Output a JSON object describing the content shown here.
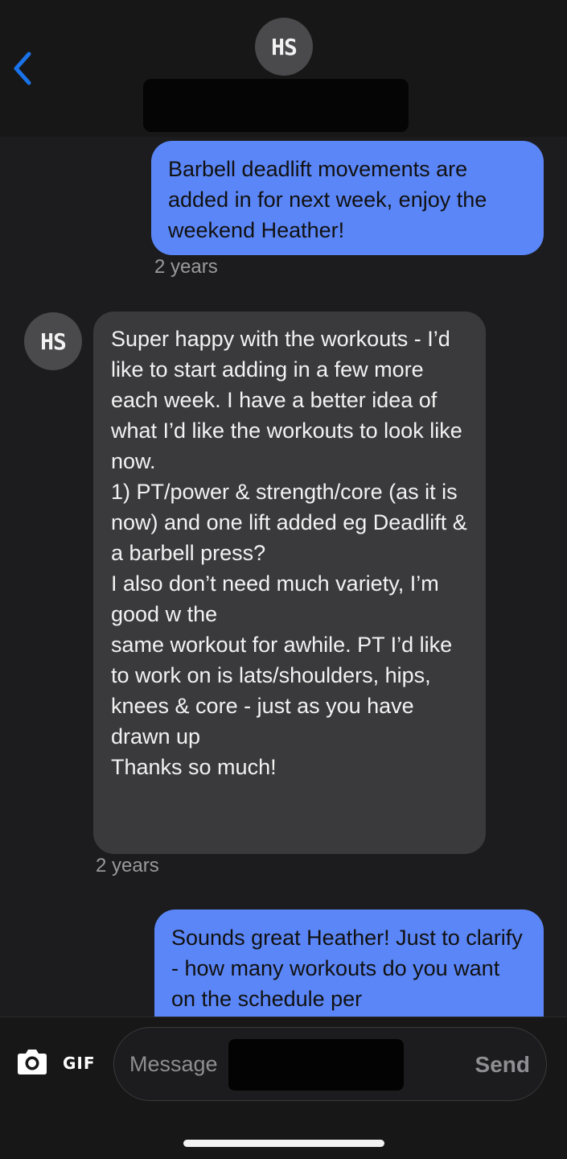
{
  "header": {
    "avatar_initials": "HS",
    "back_icon": "chevron-left-icon",
    "accent_color": "#1a73e8"
  },
  "messages": [
    {
      "direction": "outgoing",
      "text": "Barbell deadlift movements are added in for next week, enjoy the weekend Heather!",
      "time": "2 years"
    },
    {
      "direction": "incoming",
      "avatar_initials": "HS",
      "text": "Super happy with the workouts - I’d like to start adding in a few more each week. I have a better idea of what I’d like the workouts to look like now.\n1) PT/power & strength/core (as it is now) and one lift added eg Deadlift & a barbell press?\nI also don’t need much variety, I’m good w the\nsame workout for awhile. PT I’d like to work on is lats/shoulders, hips, knees & core - just as you have drawn up\nThanks so much!",
      "time": "2 years"
    },
    {
      "direction": "outgoing",
      "text": "Sounds great Heather! Just to clarify - how many workouts do you want on the schedule per"
    }
  ],
  "composer": {
    "camera_icon": "camera-icon",
    "gif_label": "GIF",
    "placeholder": "Message",
    "send_label": "Send"
  },
  "colors": {
    "outgoing_bubble": "#5b86f7",
    "incoming_bubble": "#3a3a3c",
    "background": "#1c1c1e"
  }
}
